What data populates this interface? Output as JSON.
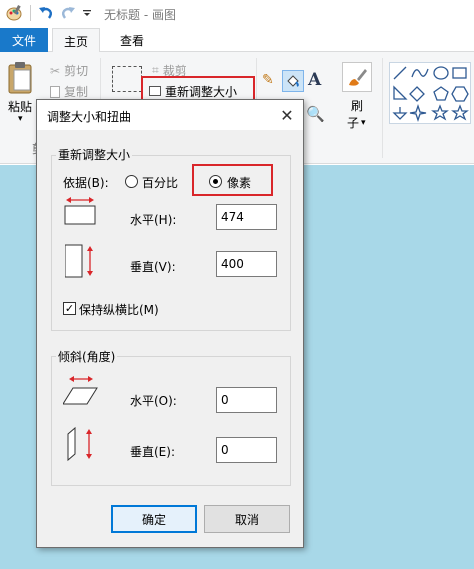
{
  "window": {
    "title": "无标题 - 画图"
  },
  "ribbon_tabs": {
    "file": "文件",
    "home": "主页",
    "view": "查看"
  },
  "ribbon": {
    "paste": "粘贴",
    "cut": "剪切",
    "copy": "复制",
    "crop": "裁剪",
    "resize": "重新调整大小",
    "brush": "刷",
    "brush2": "子",
    "clipboard_group": "剪"
  },
  "dialog": {
    "title": "调整大小和扭曲",
    "resize_group": "重新调整大小",
    "by_label": "依据(B):",
    "percent_option": "百分比",
    "pixels_option": "像素",
    "horizontal_label": "水平(H):",
    "horizontal_value": "474",
    "vertical_label": "垂直(V):",
    "vertical_value": "400",
    "keep_aspect": "保持纵横比(M)",
    "skew_group": "倾斜(角度)",
    "skew_horizontal_label": "水平(O):",
    "skew_horizontal_value": "0",
    "skew_vertical_label": "垂直(E):",
    "skew_vertical_value": "0",
    "ok": "确定",
    "cancel": "取消",
    "selected_unit": "pixels",
    "keep_aspect_checked": true
  },
  "colors": {
    "accent": "#1979ca",
    "highlight": "#d9262a",
    "canvas": "#a8d8e8"
  }
}
